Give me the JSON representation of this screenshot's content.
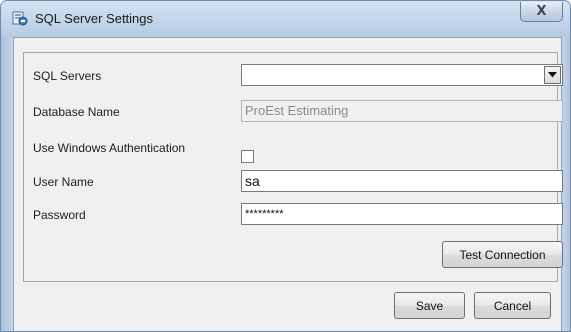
{
  "window": {
    "title": "SQL Server Settings",
    "close_glyph": "X"
  },
  "form": {
    "sql_servers": {
      "label": "SQL Servers",
      "value": ""
    },
    "database_name": {
      "label": "Database Name",
      "value": "ProEst Estimating"
    },
    "windows_auth": {
      "label": "Use Windows Authentication",
      "checked": false
    },
    "user_name": {
      "label": "User Name",
      "value": "sa"
    },
    "password": {
      "label": "Password",
      "value": "*********"
    },
    "test_connection_label": "Test Connection"
  },
  "footer": {
    "save_label": "Save",
    "cancel_label": "Cancel"
  },
  "icons": {
    "app": "database-server-icon",
    "dropdown": "chevron-down-icon",
    "close": "close-icon"
  }
}
